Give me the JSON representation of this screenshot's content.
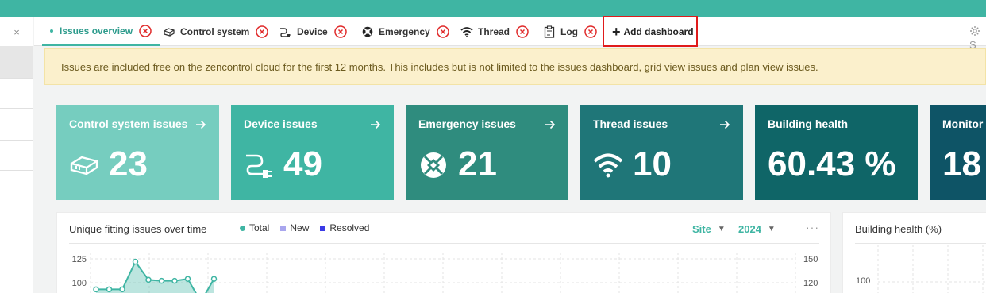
{
  "app": {
    "accent": "#3fb5a3",
    "highlight_border": "#e01b1b"
  },
  "left_pane": {
    "close_symbol": "×"
  },
  "tabs": [
    {
      "label": "Issues overview",
      "icon": "dot-icon",
      "active": true
    },
    {
      "label": "Control system",
      "icon": "controller-icon"
    },
    {
      "label": "Device",
      "icon": "plug-icon"
    },
    {
      "label": "Emergency",
      "icon": "emergency-icon"
    },
    {
      "label": "Thread",
      "icon": "wifi-icon"
    },
    {
      "label": "Log",
      "icon": "clipboard-icon"
    }
  ],
  "add_dashboard": {
    "label": "Add dashboard",
    "icon": "plus-icon"
  },
  "settings": {
    "icon": "gear-icon",
    "label": "S"
  },
  "banner": {
    "text": "Issues are included free on the zencontrol cloud for the first 12 months. This includes but is not limited to the issues dashboard, grid view issues and plan view issues."
  },
  "cards": [
    {
      "title": "Control system issues",
      "value": "23",
      "icon": "controller-icon",
      "color": "#76cdbf"
    },
    {
      "title": "Device issues",
      "value": "49",
      "icon": "plug-icon",
      "color": "#3fb5a3"
    },
    {
      "title": "Emergency issues",
      "value": "21",
      "icon": "emergency-icon",
      "color": "#2f8c7e"
    },
    {
      "title": "Thread issues",
      "value": "10",
      "icon": "wifi-icon",
      "color": "#1f7678"
    },
    {
      "title": "Building health",
      "value": "60.43 %",
      "color": "#0f6567"
    },
    {
      "title": "Monitor",
      "value": "18",
      "color": "#0e5466"
    }
  ],
  "fitting_panel": {
    "title": "Unique fitting issues over time",
    "legend": [
      {
        "label": "Total",
        "color": "#3fb5a3"
      },
      {
        "label": "New",
        "color": "#a9a6ee"
      },
      {
        "label": "Resolved",
        "color": "#3a3ae6"
      }
    ],
    "site_label": "Site",
    "year_label": "2024",
    "more_label": "···"
  },
  "health_panel": {
    "title": "Building health (%)",
    "y_tick": "100"
  },
  "chart_data": {
    "type": "area",
    "title": "Unique fitting issues over time",
    "series": [
      {
        "name": "Total",
        "values": [
          93,
          93,
          93,
          122,
          103,
          102,
          102,
          104,
          80,
          104
        ]
      }
    ],
    "y_left_ticks": [
      "125",
      "100"
    ],
    "y_right_ticks": [
      "150",
      "120"
    ],
    "ylim": [
      62.5,
      125
    ],
    "grid": true
  }
}
